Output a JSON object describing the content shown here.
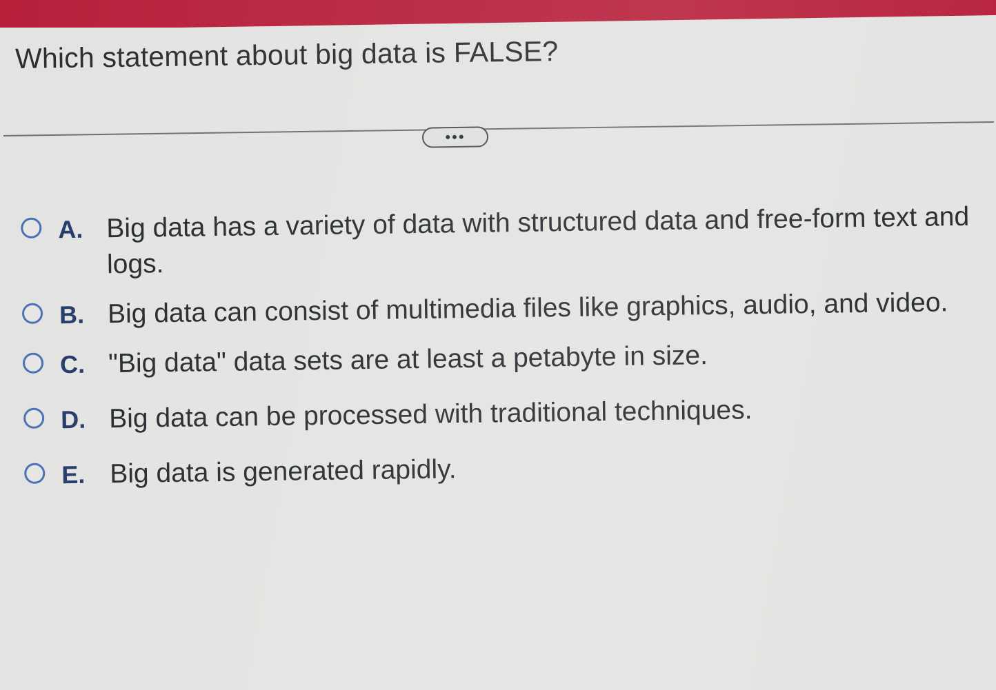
{
  "question": {
    "text": "Which statement about big data is FALSE?"
  },
  "expand_button": {
    "label": "•••"
  },
  "options": [
    {
      "letter": "A.",
      "text": "Big data has a variety of data with structured data and free-form text and logs."
    },
    {
      "letter": "B.",
      "text": "Big data can consist of multimedia files like graphics, audio, and video."
    },
    {
      "letter": "C.",
      "text": "\"Big data\" data sets are at least a petabyte in size."
    },
    {
      "letter": "D.",
      "text": "Big data can be processed with traditional techniques."
    },
    {
      "letter": "E.",
      "text": "Big data is generated rapidly."
    }
  ],
  "colors": {
    "top_bar": "#b8203c",
    "radio_border": "#4a6fb5",
    "letter": "#243a6a",
    "background": "#e3e4e1"
  }
}
